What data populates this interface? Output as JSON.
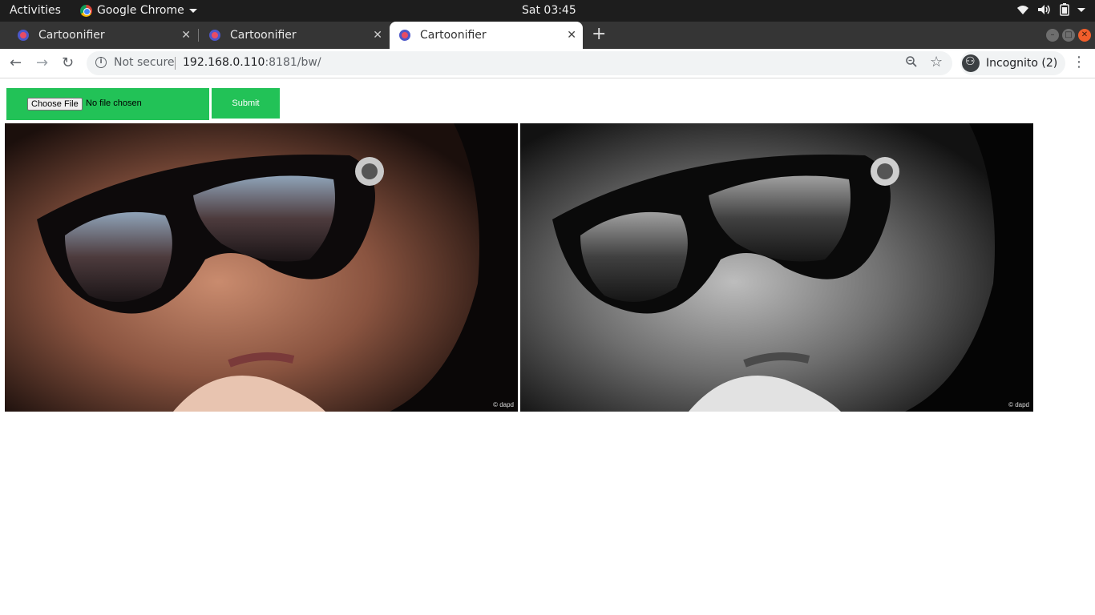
{
  "system_bar": {
    "activities": "Activities",
    "app_name": "Google Chrome",
    "clock": "Sat 03:45",
    "tray_icons": [
      "wifi-icon",
      "volume-icon",
      "battery-icon",
      "system-menu-caret"
    ]
  },
  "tabs": [
    {
      "title": "Cartoonifier",
      "active": false
    },
    {
      "title": "Cartoonifier",
      "active": false
    },
    {
      "title": "Cartoonifier",
      "active": true
    }
  ],
  "toolbar": {
    "security_label": "Not secure",
    "url_host": "192.168.0.110",
    "url_rest": ":8181/bw/",
    "profile_label": "Incognito (2)"
  },
  "page": {
    "file_button_label": "Choose File",
    "file_status": "No file chosen",
    "submit_label": "Submit",
    "original_image": {
      "credit": "© dapd",
      "tone": "color"
    },
    "processed_image": {
      "credit": "© dapd",
      "tone": "grayscale"
    }
  },
  "colors": {
    "form_green": "#22c257",
    "topbar": "#1d1d1d",
    "tabstrip": "#353535"
  }
}
